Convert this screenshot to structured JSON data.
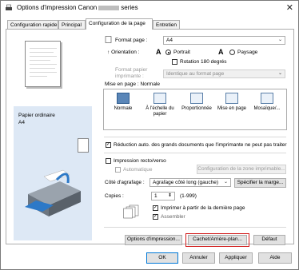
{
  "window": {
    "title_prefix": "Options d'impression Canon",
    "title_suffix": "series",
    "close": "✕"
  },
  "tabs": [
    "Configuration rapide",
    "Principal",
    "Configuration de la page",
    "Entretien"
  ],
  "page": {
    "format_label": "Format page :",
    "format_value": "A4",
    "orientation_label": "Orientation :",
    "portrait": "Portrait",
    "paysage": "Paysage",
    "rotation": "Rotation 180 degrés",
    "paper_format_label_1": "Format papier",
    "paper_format_label_2": "imprimante :",
    "paper_format_value": "Identique au format page",
    "layout_label": "Mise en page : Normale",
    "layouts": [
      {
        "label": "Normale"
      },
      {
        "label": "À l'échelle du papier"
      },
      {
        "label": "Proportionnée"
      },
      {
        "label": "Mise en page"
      },
      {
        "label": "Mosaïque/..."
      }
    ],
    "reduce": "Réduction auto. des grands documents que l'imprimante ne peut pas traiter",
    "duplex": "Impression recto/verso",
    "automatic": "Automatique",
    "zone_button": "Configuration de la zone imprimable...",
    "stapling_label": "Côté d'agrafage :",
    "stapling_value": "Agrafage côté long (gauche)",
    "margin_button": "Spécifier la marge...",
    "copies_label": "Copies :",
    "copies_value": "1",
    "copies_range": "(1-999)",
    "last_page": "Imprimer à partir de la dernière page",
    "assemble": "Assembler",
    "options_button": "Options d'impression...",
    "stamp_button": "Cachet/Arrière-plan...",
    "default_button": "Défaut"
  },
  "info": {
    "paper": "Papier ordinaire",
    "size": "A4"
  },
  "footer": {
    "ok": "OK",
    "cancel": "Annuler",
    "apply": "Appliquer",
    "help": "Aide"
  }
}
